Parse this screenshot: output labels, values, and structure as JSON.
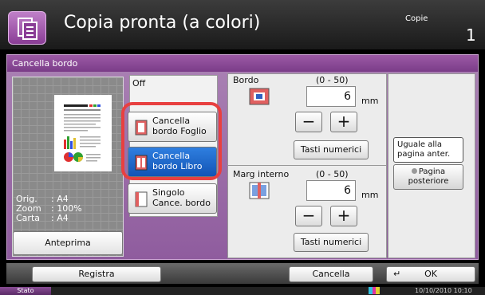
{
  "header": {
    "title": "Copia pronta (a colori)",
    "copies_label": "Copie",
    "copies_count": "1"
  },
  "section": {
    "title": "Cancella bordo"
  },
  "preview": {
    "rows": [
      {
        "key": "Orig.",
        "value": ": A4"
      },
      {
        "key": "Zoom",
        "value": ": 100%"
      },
      {
        "key": "Carta",
        "value": ": A4"
      }
    ],
    "button_label": "Anteprima"
  },
  "options": {
    "off_label": "Off",
    "items": [
      {
        "label": "Cancella bordo Foglio",
        "selected": false
      },
      {
        "label": "Cancella bordo Libro",
        "selected": true
      },
      {
        "label": "Singolo Cance. bordo",
        "selected": false
      }
    ]
  },
  "bordo": {
    "label": "Bordo",
    "range": "(0 - 50)",
    "value": "6",
    "unit": "mm",
    "minus": "−",
    "plus": "+",
    "keypad": "Tasti numerici"
  },
  "margine": {
    "label": "Marg interno",
    "range": "(0 - 50)",
    "value": "6",
    "unit": "mm",
    "minus": "−",
    "plus": "+",
    "keypad": "Tasti numerici"
  },
  "back_page": {
    "same_label": "Uguale alla pagina anter.",
    "back_label": "Pagina posteriore"
  },
  "footer": {
    "register": "Registra",
    "cancel": "Cancella",
    "ok": "OK",
    "status": "Stato",
    "datetime": "10/10/2010 10:10"
  },
  "colors": {
    "accent_purple": "#8f5c9e",
    "selected_blue": "#1f6fd0",
    "highlight_red": "#e84040"
  }
}
